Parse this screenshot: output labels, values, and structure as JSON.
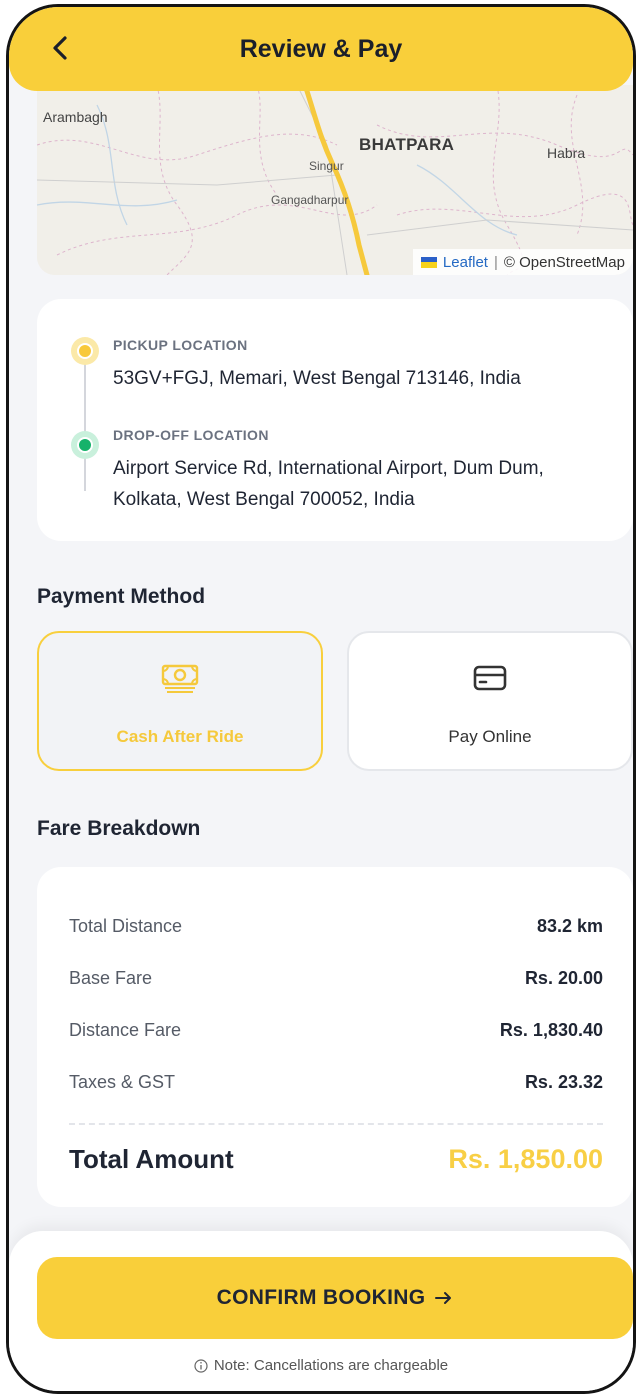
{
  "header": {
    "title": "Review & Pay",
    "back_icon": "chevron-left-icon",
    "background": "#f9cf3a"
  },
  "map": {
    "places": {
      "arambagh": "Arambagh",
      "bhatpara": "BHATPARA",
      "habra": "Habra",
      "singur": "Singur",
      "gangadharpur": "Gangadharpur"
    },
    "attribution": {
      "leaflet": "Leaflet",
      "separator": "|",
      "osm": "© OpenStreetMap"
    },
    "route_color": "#f6c93c"
  },
  "route": {
    "pickup_label": "PICKUP LOCATION",
    "pickup_address": "53GV+FGJ, Memari, West Bengal 713146, India",
    "dropoff_label": "DROP-OFF LOCATION",
    "dropoff_address": "Airport Service Rd, International Airport, Dum Dum, Kolkata, West Bengal 700052, India"
  },
  "payment": {
    "title": "Payment Method",
    "options": [
      {
        "label": "Cash After Ride",
        "icon": "cash-icon",
        "selected": true
      },
      {
        "label": "Pay Online",
        "icon": "credit-card-icon",
        "selected": false
      }
    ]
  },
  "fare": {
    "title": "Fare Breakdown",
    "rows": [
      {
        "label": "Total Distance",
        "value": "83.2 km"
      },
      {
        "label": "Base Fare",
        "value": "Rs. 20.00"
      },
      {
        "label": "Distance Fare",
        "value": "Rs. 1,830.40"
      },
      {
        "label": "Taxes & GST",
        "value": "Rs. 23.32"
      }
    ],
    "total_label": "Total Amount",
    "total_value": "Rs. 1,850.00",
    "total_color": "#f8cf45"
  },
  "footer": {
    "confirm_label": "CONFIRM BOOKING",
    "confirm_icon": "arrow-right-icon",
    "note_icon": "info-icon",
    "note": "Note: Cancellations are chargeable"
  }
}
